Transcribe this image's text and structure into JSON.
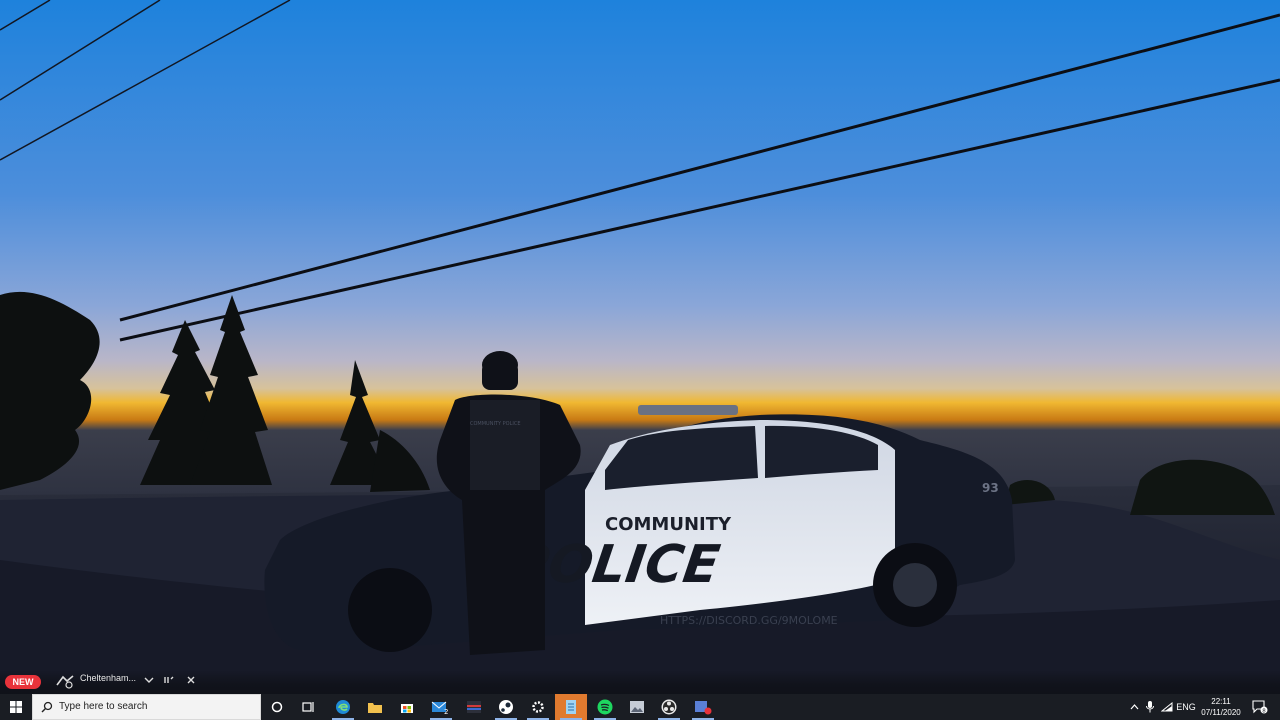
{
  "desktop": {
    "wallpaper": {
      "car_brand_line1": "COMMUNITY",
      "car_brand_line2": "POLICE",
      "car_url": "HTTPS://DISCORD.GG/9MOLOME",
      "car_number": "93",
      "vest_text": "COMMUNITY POLICE"
    }
  },
  "notification": {
    "badge": "NEW",
    "text": "Cheltenham..."
  },
  "taskbar": {
    "search_placeholder": "Type here to search",
    "mail_badge": "2",
    "language": "ENG",
    "time": "22:11",
    "date": "07/11/2020",
    "notification_count": "8",
    "colors": {
      "taskbar_bg": "#1a1d23",
      "active_bg": "#e07a2f",
      "badge_red": "#e8333b"
    },
    "icons": [
      "start-icon",
      "search-icon",
      "cortana-icon",
      "task-view-icon",
      "edge-icon",
      "file-explorer-icon",
      "store-icon",
      "mail-icon",
      "app-icon",
      "steam-icon",
      "settings-icon",
      "notepad-icon",
      "spotify-icon",
      "photos-icon",
      "obs-icon",
      "app-badge-icon"
    ]
  }
}
